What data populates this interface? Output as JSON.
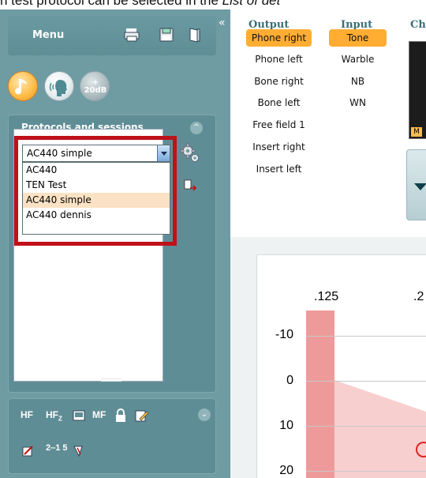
{
  "caption": {
    "prefix": "n test protocol can be selected in the ",
    "italic": "List of det"
  },
  "left_panel": {
    "collapse_glyph": "«",
    "menu_label": "Menu",
    "menu_icons": [
      "print-icon",
      "save-icon",
      "exit-door-icon"
    ],
    "mode_buttons": [
      "tone-audiometry-icon",
      "speech-audiometry-icon",
      "plus-20db-icon"
    ],
    "plus20_line1": "+",
    "plus20_line2": "20dB",
    "protocols": {
      "title": "Protocols and sessions",
      "collapse_glyph": "^",
      "selected": "AC440 simple",
      "options": [
        "AC440",
        "TEN Test",
        "AC440 simple",
        "AC440 dennis"
      ],
      "highlighted_option": "AC440 simple"
    },
    "toolbar": {
      "row1": [
        "HF",
        "HF",
        "MF"
      ],
      "row1_icons": [
        "hf-icon",
        "hfz-icon",
        "monitor-icon",
        "mf-icon",
        "lock-icon",
        "edit-icon"
      ],
      "row2_icons": [
        "swap-icon",
        "5-1-icon",
        "transducer-icon"
      ],
      "hfz_sub": "Z",
      "row2_label": "2‒1 5"
    }
  },
  "output": {
    "header": "Output",
    "items": [
      "Phone right",
      "Phone left",
      "Bone right",
      "Bone left",
      "Free field 1",
      "Insert right",
      "Insert left"
    ],
    "active": "Phone right"
  },
  "input": {
    "header": "Input",
    "items": [
      "Tone",
      "Warble",
      "NB",
      "WN"
    ],
    "active": "Tone"
  },
  "partial_header": "Ch",
  "dark_panel_tag": "M",
  "graph": {
    "freq_labels": [
      ".125",
      ".2"
    ],
    "db_labels": [
      "-10",
      "0",
      "10",
      "20"
    ],
    "colors": {
      "band": "#ef9a9a",
      "region": "#f8cfcf",
      "marker": "#e02424",
      "highlight": "#c0101a",
      "active": "#ffad33"
    }
  }
}
